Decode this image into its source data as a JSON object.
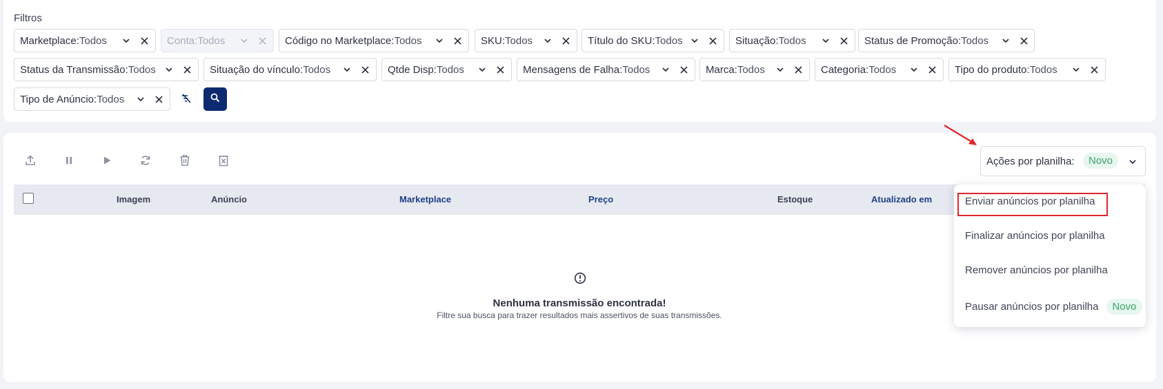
{
  "filters": {
    "title": "Filtros",
    "chips": [
      {
        "key": "Marketplace:",
        "value": " Todos"
      },
      {
        "key": "Conta:",
        "value": " Todos"
      },
      {
        "key": "Código no Marketplace:",
        "value": "Todos"
      },
      {
        "key": "SKU:",
        "value": "Todos"
      },
      {
        "key": "Título do SKU:",
        "value": "Todos"
      },
      {
        "key": "Situação:",
        "value": "Todos"
      },
      {
        "key": "Status de Promoção:",
        "value": "Todos"
      },
      {
        "key": "Status da Transmissão:",
        "value": "Todos"
      },
      {
        "key": "Situação do vínculo:",
        "value": "Todos"
      },
      {
        "key": "Qtde Disp:",
        "value": "Todos"
      },
      {
        "key": "Mensagens de Falha:",
        "value": " Todos"
      },
      {
        "key": "Marca:",
        "value": "Todos"
      },
      {
        "key": "Categoria:",
        "value": "Todos"
      },
      {
        "key": "Tipo do produto:",
        "value": "Todos"
      },
      {
        "key": "Tipo de Anúncio:",
        "value": "Todos"
      }
    ]
  },
  "toolbar": {
    "icons": [
      "upload-icon",
      "pause-icon",
      "play-icon",
      "sync-icon",
      "trash-icon",
      "delete-box-icon"
    ]
  },
  "actions": {
    "label": "Ações por planilha:",
    "badge": "Novo",
    "menu": [
      {
        "label": "Enviar anúncios por planilha"
      },
      {
        "label": "Finalizar anúncios por planilha"
      },
      {
        "label": "Remover anúncios por planilha"
      },
      {
        "label": "Pausar anúncios por planilha",
        "badge": "Novo"
      }
    ]
  },
  "table": {
    "columns": [
      "Imagem",
      "Anúncio",
      "Marketplace",
      "Preço",
      "Estoque",
      "Atualizado em"
    ]
  },
  "empty": {
    "title": "Nenhuma transmissão encontrada!",
    "subtitle": "Filtre sua busca para trazer resultados mais assertivos de suas transmissões."
  },
  "colors": {
    "primary": "#0b2a6f",
    "highlight": "#e0242b",
    "badge_bg": "#e7f6ee",
    "badge_text": "#3aa66a",
    "table_header": "#e6e9f0"
  }
}
